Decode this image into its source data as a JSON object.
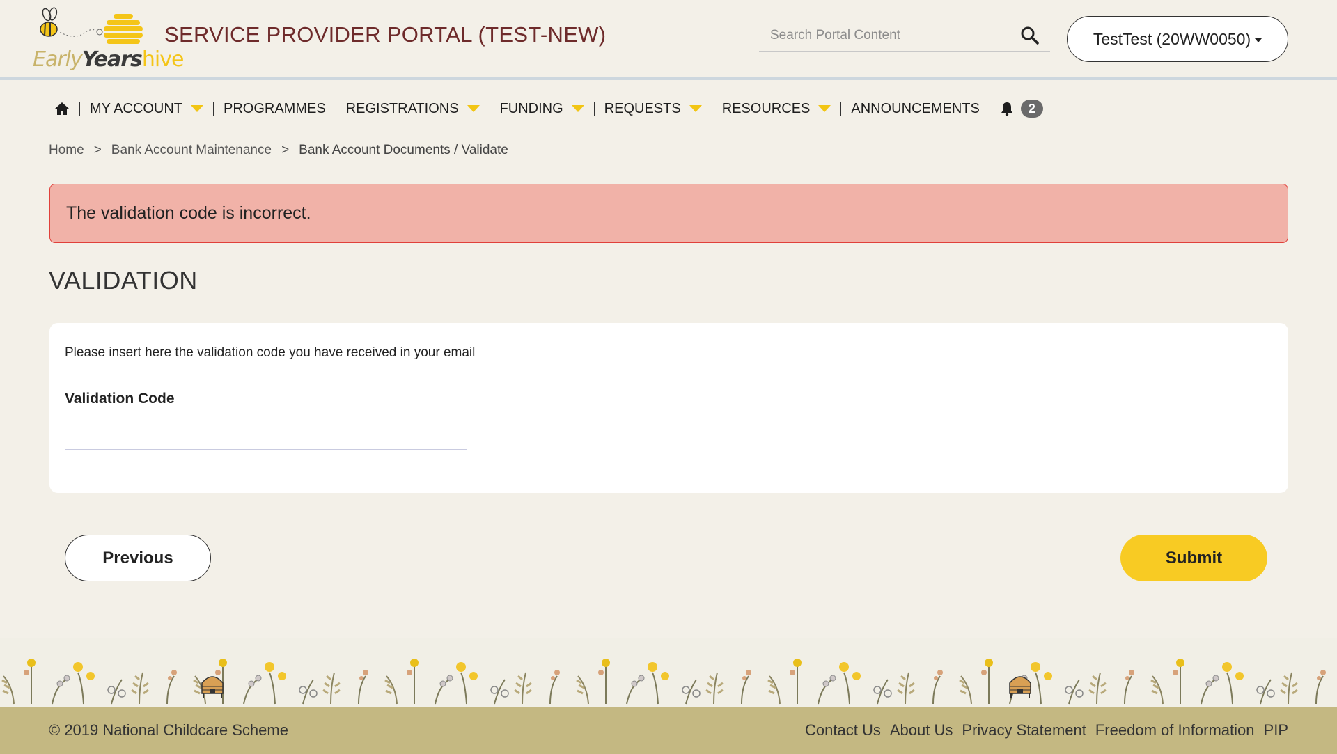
{
  "header": {
    "logo": {
      "early": "Early",
      "years": "Years",
      "hive": "hive"
    },
    "portal_title": "SERVICE PROVIDER PORTAL (TEST-NEW)",
    "search_placeholder": "Search Portal Content",
    "account_label": "TestTest (20WW0050)"
  },
  "nav": {
    "items": [
      {
        "label": "MY ACCOUNT"
      },
      {
        "label": "PROGRAMMES"
      },
      {
        "label": "REGISTRATIONS"
      },
      {
        "label": "FUNDING"
      },
      {
        "label": "REQUESTS"
      },
      {
        "label": "RESOURCES"
      },
      {
        "label": "ANNOUNCEMENTS"
      }
    ],
    "notification_count": "2"
  },
  "breadcrumb": {
    "home": "Home",
    "parent": "Bank Account Maintenance",
    "separator": ">",
    "current": "Bank Account Documents / Validate"
  },
  "alert": {
    "message": "The validation code is incorrect."
  },
  "main": {
    "title": "VALIDATION",
    "instruction": "Please insert here the validation code you have received in your email",
    "field_label": "Validation Code",
    "field_value": ""
  },
  "actions": {
    "previous": "Previous",
    "submit": "Submit"
  },
  "footer": {
    "copyright": "© 2019 National Childcare Scheme",
    "links": [
      "Contact Us",
      "About Us",
      "Privacy Statement",
      "Freedom of Information",
      "PIP"
    ]
  },
  "colors": {
    "title_red": "#6e2b2b",
    "accent_yellow": "#f8cb23",
    "alert_bg": "#f1b2a8",
    "alert_border": "#e0403a",
    "footer_bg": "#c4b882"
  }
}
